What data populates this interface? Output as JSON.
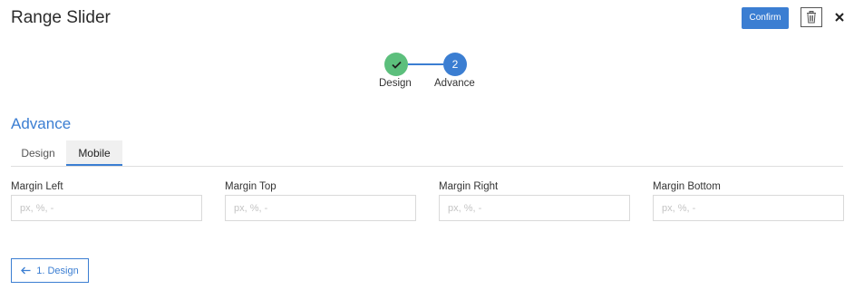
{
  "header": {
    "title": "Range Slider",
    "confirm_label": "Confirm",
    "delete_icon": "trash-icon",
    "close_icon": "close-icon"
  },
  "stepper": {
    "steps": [
      {
        "number": "1",
        "label": "Design",
        "status": "completed",
        "icon": "check-icon"
      },
      {
        "number": "2",
        "label": "Advance",
        "status": "active"
      }
    ]
  },
  "section": {
    "title": "Advance"
  },
  "tabs": [
    {
      "label": "Design",
      "active": false
    },
    {
      "label": "Mobile",
      "active": true
    }
  ],
  "fields": [
    {
      "label": "Margin Left",
      "value": "",
      "placeholder": "px, %, -"
    },
    {
      "label": "Margin Top",
      "value": "",
      "placeholder": "px, %, -"
    },
    {
      "label": "Margin Right",
      "value": "",
      "placeholder": "px, %, -"
    },
    {
      "label": "Margin Bottom",
      "value": "",
      "placeholder": "px, %, -"
    }
  ],
  "footer": {
    "back_label": "1. Design",
    "back_icon": "arrow-left-icon"
  },
  "colors": {
    "primary": "#3b7ed2",
    "success": "#5cbf7c"
  }
}
